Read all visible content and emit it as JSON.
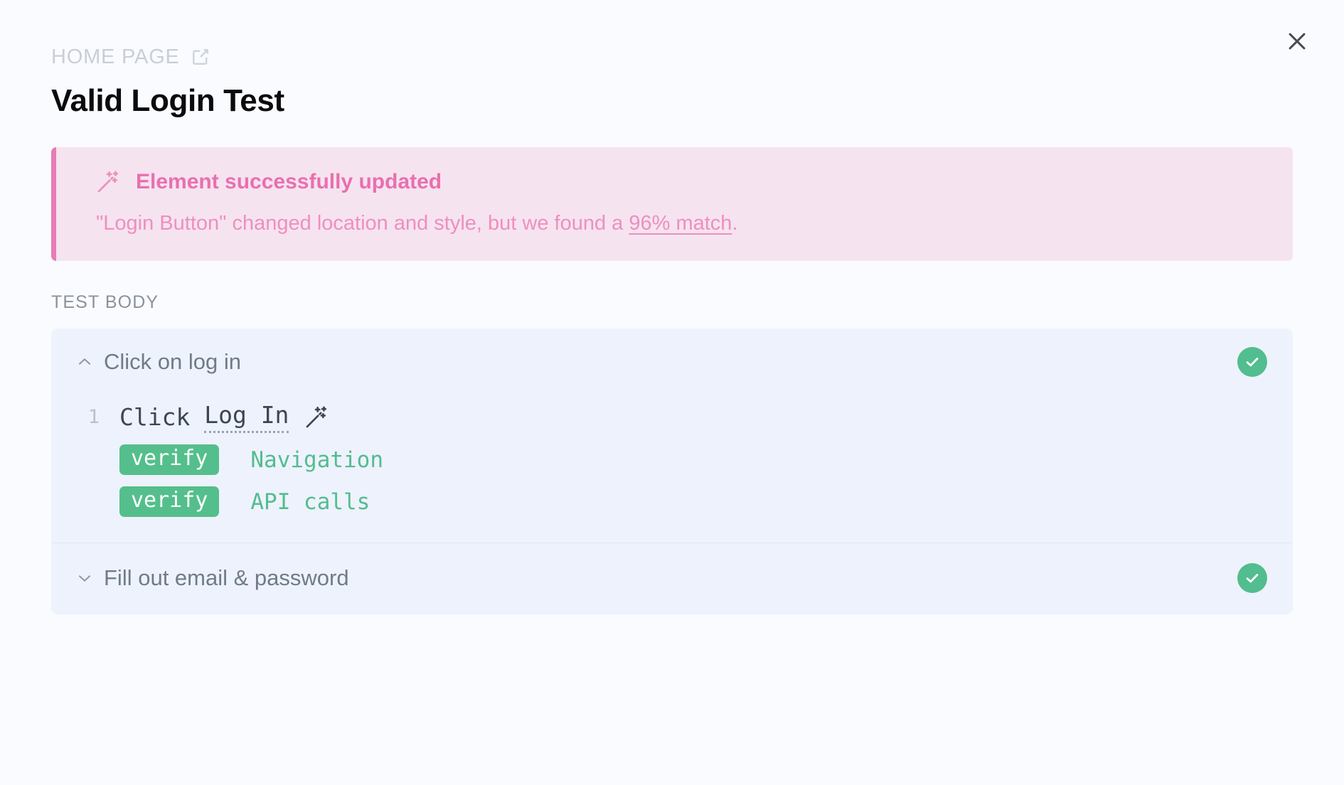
{
  "window": {
    "close_icon": "close-icon"
  },
  "header": {
    "breadcrumb": "HOME PAGE",
    "breadcrumb_icon": "external-link-icon",
    "title": "Valid Login Test"
  },
  "banner": {
    "icon": "magic-wand-icon",
    "title": "Element successfully updated",
    "message_prefix": "\"Login Button\" changed location and style, but we found a ",
    "link_text": "96% match",
    "message_suffix": ".",
    "accent_color": "#e87cb6",
    "background_color": "#f6e3f0",
    "text_color": "#ee8fbf"
  },
  "test_body": {
    "section_label": "TEST BODY",
    "groups": [
      {
        "title": "Click on log in",
        "expanded": true,
        "chevron_icon": "chevron-up-icon",
        "status": "passed",
        "status_icon": "check-circle-icon",
        "steps": [
          {
            "line_number": "1",
            "action": "Click",
            "element": "Log In",
            "element_icon": "magic-wand-icon"
          }
        ],
        "assertions": [
          {
            "keyword": "verify",
            "target": "Navigation"
          },
          {
            "keyword": "verify",
            "target": "API calls"
          }
        ]
      },
      {
        "title": "Fill out email & password",
        "expanded": false,
        "chevron_icon": "chevron-down-icon",
        "status": "passed",
        "status_icon": "check-circle-icon"
      }
    ],
    "colors": {
      "card_background": "#eef2fc",
      "success": "#52bd8f",
      "code_text": "#3c4653"
    }
  }
}
